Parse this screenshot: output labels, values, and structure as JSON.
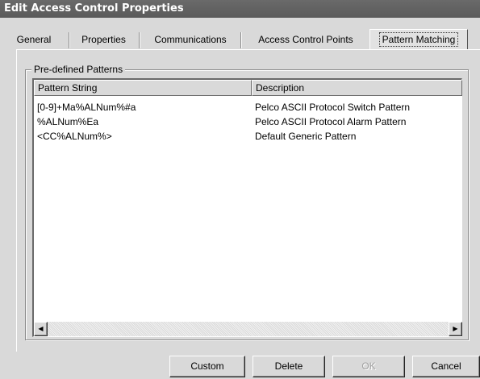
{
  "window": {
    "title": "Edit Access Control Properties"
  },
  "tabs": [
    {
      "label": "General"
    },
    {
      "label": "Properties"
    },
    {
      "label": "Communications"
    },
    {
      "label": "Access Control Points"
    },
    {
      "label": "Pattern Matching",
      "active": true
    }
  ],
  "group": {
    "label": "Pre-defined Patterns"
  },
  "table": {
    "columns": [
      "Pattern String",
      "Description"
    ],
    "rows": [
      {
        "pattern": "[0-9]+Ma%ALNum%#a",
        "description": "Pelco ASCII Protocol Switch Pattern"
      },
      {
        "pattern": "%ALNum%Ea",
        "description": "Pelco ASCII Protocol Alarm Pattern"
      },
      {
        "pattern": "<CC%ALNum%>",
        "description": "Default Generic Pattern"
      }
    ]
  },
  "scrollbar": {
    "left_icon": "scroll-left-icon",
    "right_icon": "scroll-right-icon"
  },
  "buttons": {
    "custom": "Custom",
    "delete": "Delete",
    "ok": "OK",
    "cancel": "Cancel"
  },
  "colors": {
    "title_bar": "#5e5e5e",
    "dialog_bg": "#d9d9d9",
    "list_bg": "#ffffff"
  }
}
